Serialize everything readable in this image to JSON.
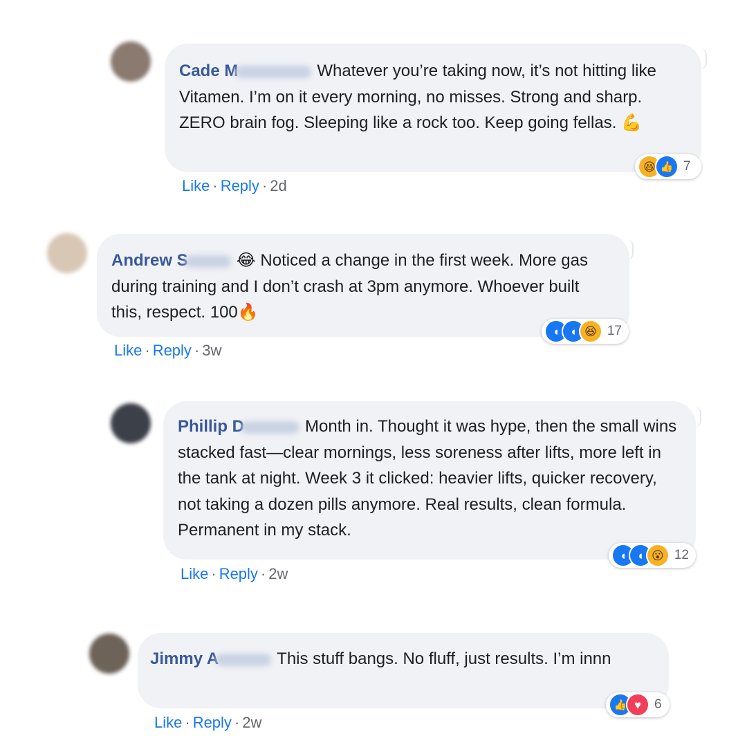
{
  "comments": [
    {
      "author": "Cade M",
      "text": "Whatever you’re taking now, it’s not hitting like Vitamen. I’m on it every morning, no misses. Strong and sharp. ZERO brain fog. Sleeping like a rock too. Keep going fellas.",
      "emoji": "💪",
      "reaction_count": "7",
      "reactions": [
        "haha-icon",
        "like-icon"
      ],
      "like_label": "Like",
      "reply_label": "Reply",
      "time": "2d"
    },
    {
      "author": "Andrew S",
      "lead_emoji": "😂",
      "text": "Noticed a change in the first week. More gas during training and I don’t crash at 3pm anymore. Whoever built this, respect. 100",
      "emoji": "🔥",
      "reaction_count": "17",
      "reactions": [
        "care-icon",
        "care-icon",
        "haha-icon"
      ],
      "like_label": "Like",
      "reply_label": "Reply",
      "time": "3w"
    },
    {
      "author": "Phillip D",
      "text": "Month in. Thought it was hype, then the small wins stacked fast—clear mornings, less soreness after lifts, more left in the tank at night. Week 3 it clicked: heavier lifts, quicker recovery, not taking a dozen pills anymore. Real results, clean formula. Permanent in my stack.",
      "reaction_count": "12",
      "reactions": [
        "care-icon",
        "care-icon",
        "wow-icon"
      ],
      "like_label": "Like",
      "reply_label": "Reply",
      "time": "2w"
    },
    {
      "author": "Jimmy A",
      "text": "This stuff bangs. No fluff, just results. I’m innn",
      "reaction_count": "6",
      "reactions": [
        "like-icon",
        "love-icon"
      ],
      "like_label": "Like",
      "reply_label": "Reply",
      "time": "2w"
    }
  ],
  "colors": {
    "bubble": "#f0f2f5",
    "author": "#385898",
    "link": "#1877f2",
    "meta": "#65676b"
  }
}
